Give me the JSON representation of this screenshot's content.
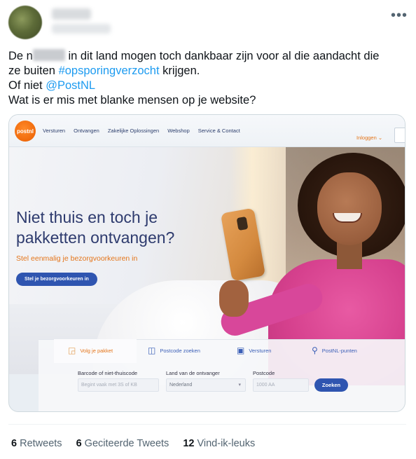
{
  "tweet": {
    "text_lines": [
      {
        "before": "De n",
        "after": " in dit land mogen toch dankbaar zijn voor al die aandacht die"
      },
      {
        "before": "ze buiten ",
        "hashtag": "#opsporingverzocht",
        "after": " krijgen."
      },
      {
        "before": "Of niet ",
        "mention": "@PostNL"
      },
      {
        "before": "Wat is er mis met blanke mensen op je website?"
      }
    ],
    "more_label": "•••"
  },
  "screenshot": {
    "logo_text": "postnl",
    "nav": [
      "Versturen",
      "Ontvangen",
      "Zakelijke Oplossingen",
      "Webshop",
      "Service & Contact"
    ],
    "login": "Inloggen ⌄",
    "hero_title_line1": "Niet thuis en toch je",
    "hero_title_line2": "pakketten ontvangen?",
    "hero_subtitle": "Stel eenmalig je bezorgvoorkeuren in",
    "hero_button": "Stel je bezorgvoorkeuren in",
    "tabs": [
      {
        "label": "Volg je pakket",
        "icon": "package-icon"
      },
      {
        "label": "Postcode zoeken",
        "icon": "map-icon"
      },
      {
        "label": "Versturen",
        "icon": "send-box-icon"
      },
      {
        "label": "PostNL-punten",
        "icon": "location-pin-icon"
      }
    ],
    "form": {
      "barcode_label": "Barcode of niet-thuiscode",
      "barcode_placeholder": "Begint vaak met 3S of KB",
      "country_label": "Land van de ontvanger",
      "country_value": "Nederland",
      "postcode_label": "Postcode",
      "postcode_placeholder": "1000 AA",
      "search_button": "Zoeken"
    }
  },
  "stats": {
    "retweets_count": "6",
    "retweets_label": "Retweets",
    "quotes_count": "6",
    "quotes_label": "Geciteerde Tweets",
    "likes_count": "12",
    "likes_label": "Vind-ik-leuks"
  },
  "colors": {
    "link": "#1d9bf0",
    "postnl_orange": "#f06a0c",
    "postnl_blue": "#2f55b0",
    "sweater_pink": "#d6418e"
  }
}
